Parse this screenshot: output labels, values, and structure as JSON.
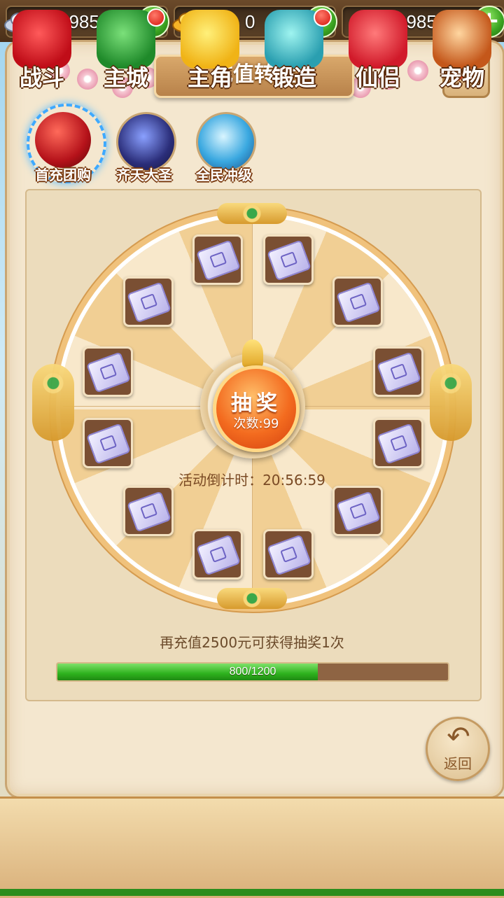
{
  "currencies": [
    {
      "icon": "silver-ingot-icon",
      "value": "29850"
    },
    {
      "icon": "gold-ingot-icon",
      "value": "0"
    },
    {
      "icon": "",
      "value": "29850"
    }
  ],
  "panel": {
    "title": "充值转盘",
    "close_icon": "close-icon"
  },
  "tabs": [
    {
      "label": "首充团购",
      "selected": true,
      "icon": "red-orb-icon"
    },
    {
      "label": "齐天大圣",
      "selected": false,
      "icon": "constellation-orb-icon"
    },
    {
      "label": "全民冲级",
      "selected": false,
      "icon": "blue-bird-orb-icon"
    }
  ],
  "wheel": {
    "item_icon": "ticket-icon",
    "item_count": 12,
    "draw_button": {
      "label": "抽奖",
      "count_text": "次数:99"
    },
    "countdown": "活动倒计时：20:56:59"
  },
  "recharge": {
    "tip": "再充值2500元可获得抽奖1次",
    "progress_text": "800/1200",
    "progress_fraction": 0.6667
  },
  "back_button": {
    "label": "返回",
    "icon": "back-arrow-icon"
  },
  "nav": [
    {
      "label": "战斗",
      "icon": "battle-icon",
      "badge": false
    },
    {
      "label": "主城",
      "icon": "city-icon",
      "badge": true
    },
    {
      "label": "主角",
      "icon": "hero-icon",
      "badge": false
    },
    {
      "label": "锻造",
      "icon": "forge-hammer-icon",
      "badge": true
    },
    {
      "label": "仙侣",
      "icon": "heart-icon",
      "badge": false
    },
    {
      "label": "宠物",
      "icon": "monkey-pet-icon",
      "badge": false
    }
  ],
  "colors": {
    "panel": "#f4e7cf",
    "accent_orange": "#f36b1f",
    "progress_green": "#2eb21e",
    "selected_ring": "#3ea9ff"
  }
}
